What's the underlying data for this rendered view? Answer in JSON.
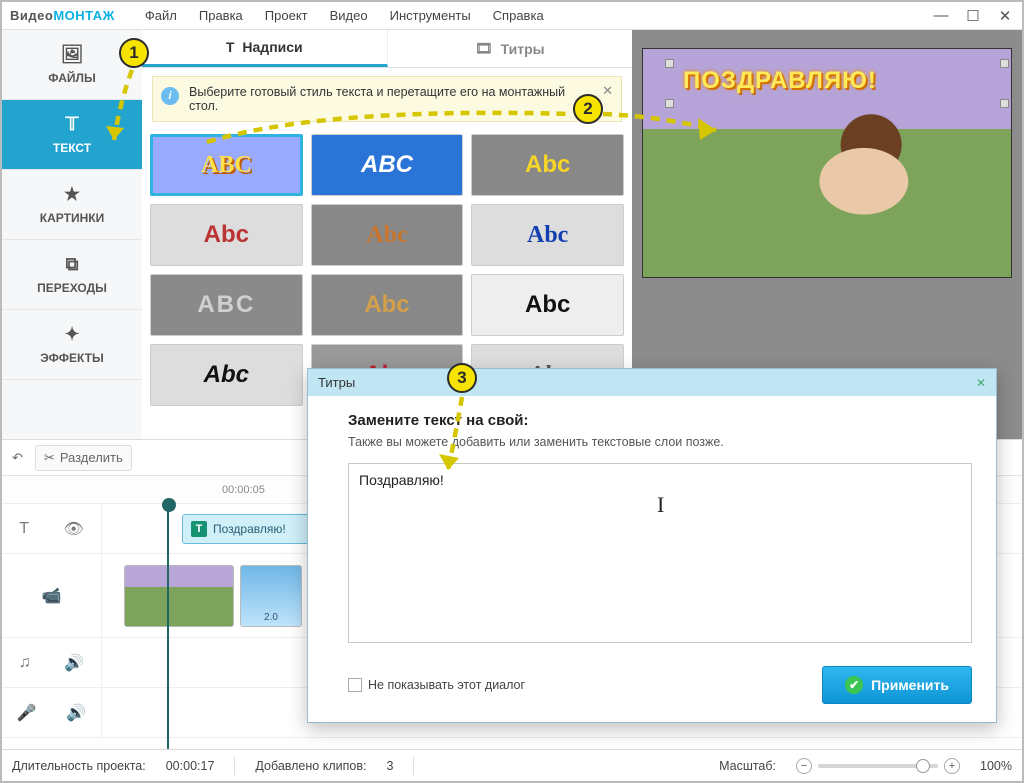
{
  "logo": {
    "a": "Видео",
    "b": "МОНТАЖ"
  },
  "menu": {
    "file": "Файл",
    "edit": "Правка",
    "project": "Проект",
    "video": "Видео",
    "tools": "Инструменты",
    "help": "Справка"
  },
  "sidebar": {
    "files": "ФАЙЛЫ",
    "text": "ТЕКСТ",
    "pictures": "КАРТИНКИ",
    "transitions": "ПЕРЕХОДЫ",
    "effects": "ЭФФЕКТЫ"
  },
  "tabs": {
    "captions": "Надписи",
    "titles": "Титры"
  },
  "hint": {
    "text": "Выберите готовый стиль текста и перетащите его на монтажный стол."
  },
  "styles": {
    "s0": "ABC",
    "s1": "ABC",
    "s2": "Abc",
    "s3": "Abc",
    "s4": "Abc",
    "s5": "Abc",
    "s6": "ABC",
    "s7": "Abc",
    "s8": "Abc",
    "s9": "Abc",
    "s10": "Abc",
    "s11": "Abc"
  },
  "preview": {
    "overlay_text": "ПОЗДРАВЛЯЮ!"
  },
  "timeline": {
    "split": "Разделить",
    "tick0": "00:00:05",
    "text_clip": "Поздравляю!",
    "clip2_dur": "2.0"
  },
  "dialog": {
    "title": "Титры",
    "heading": "Замените текст на свой:",
    "sub": "Также вы можете добавить или заменить текстовые слои позже.",
    "value": "Поздравляю!",
    "dont_show": "Не показывать этот диалог",
    "apply": "Применить"
  },
  "status": {
    "duration_label": "Длительность проекта:",
    "duration": "00:00:17",
    "clips_label": "Добавлено клипов:",
    "clips": "3",
    "zoom_label": "Масштаб:",
    "zoom_value": "100%"
  },
  "badges": {
    "b1": "1",
    "b2": "2",
    "b3": "3"
  }
}
